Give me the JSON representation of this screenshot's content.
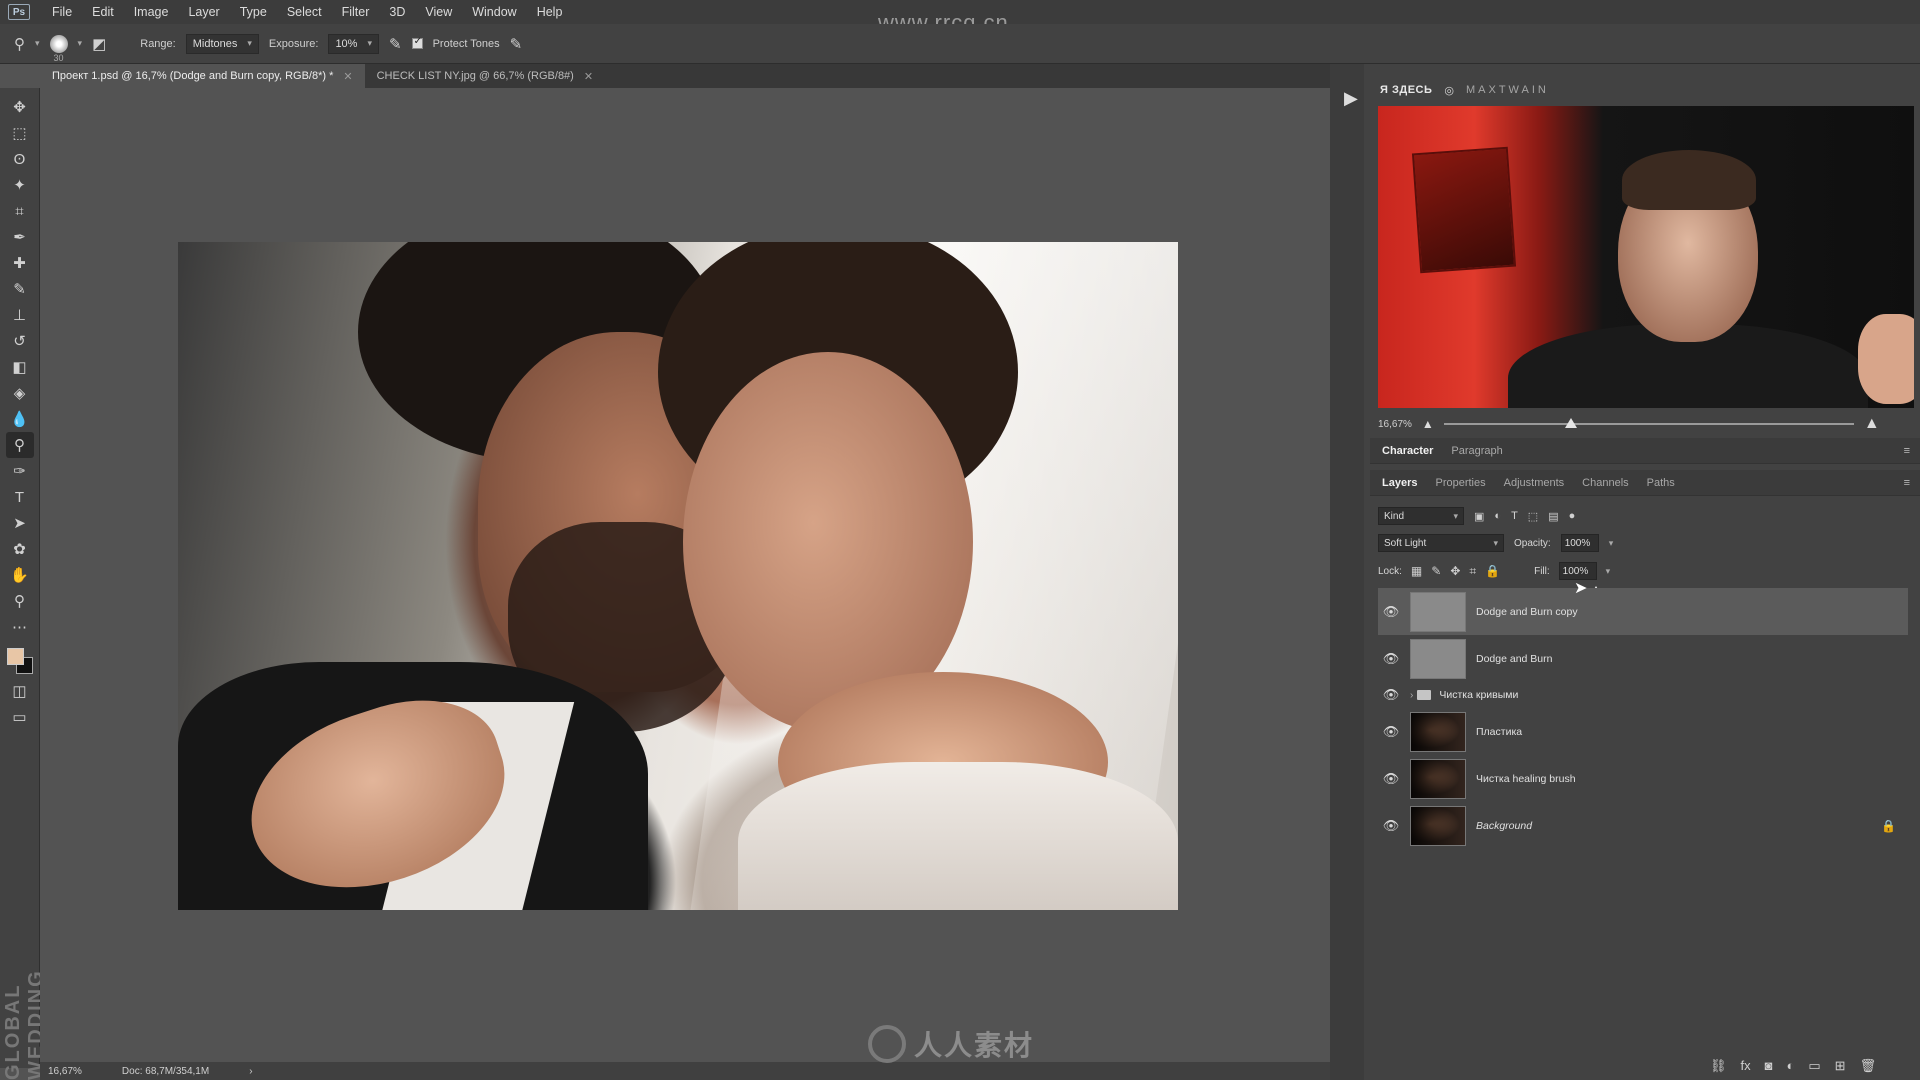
{
  "app": {
    "logo": "Ps"
  },
  "menu": [
    "File",
    "Edit",
    "Image",
    "Layer",
    "Type",
    "Select",
    "Filter",
    "3D",
    "View",
    "Window",
    "Help"
  ],
  "watermark": {
    "url": "www.rrcg.cn",
    "bottom_logo": "人人素材",
    "vertical_brand": "GLOBAL WEDDING"
  },
  "options": {
    "brush_size": "30",
    "range_label": "Range:",
    "range_value": "Midtones",
    "exposure_label": "Exposure:",
    "exposure_value": "10%",
    "protect_tones_label": "Protect Tones",
    "protect_tones_checked": true
  },
  "tabs": [
    {
      "label": "Проект 1.psd @ 16,7% (Dodge and Burn copy, RGB/8*) *",
      "active": true
    },
    {
      "label": "CHECK LIST NY.jpg @ 66,7% (RGB/8#)",
      "active": false
    }
  ],
  "colors": {
    "foreground": "#e8c6a6",
    "background": "#111111",
    "accent_red": "#e03a2c"
  },
  "webcam": {
    "here_label": "Я ЗДЕСЬ",
    "handle": "MAXTWAIN"
  },
  "navigator": {
    "zoom": "16,67%",
    "zoom_fraction": 0.31
  },
  "panel_tabs_top": [
    "Character",
    "Paragraph"
  ],
  "panel_tabs_layers": [
    "Layers",
    "Properties",
    "Adjustments",
    "Channels",
    "Paths"
  ],
  "layers_panel": {
    "filter_kind": "Kind",
    "blend_mode": "Soft Light",
    "opacity_label": "Opacity:",
    "opacity_value": "100%",
    "lock_label": "Lock:",
    "fill_label": "Fill:",
    "fill_value": "100%",
    "layers": [
      {
        "name": "Dodge and Burn copy",
        "selected": true,
        "thumb": "grey"
      },
      {
        "name": "Dodge and Burn",
        "selected": false,
        "thumb": "grey"
      },
      {
        "name": "Чистка кривыми",
        "group": true
      },
      {
        "name": "Пластика",
        "selected": false,
        "thumb": "photo"
      },
      {
        "name": "Чистка healing brush",
        "selected": false,
        "thumb": "photo"
      },
      {
        "name": "Background",
        "selected": false,
        "thumb": "photo",
        "locked": true
      }
    ]
  },
  "status": {
    "zoom": "16,67%",
    "doc": "Doc: 68,7M/354,1M"
  }
}
